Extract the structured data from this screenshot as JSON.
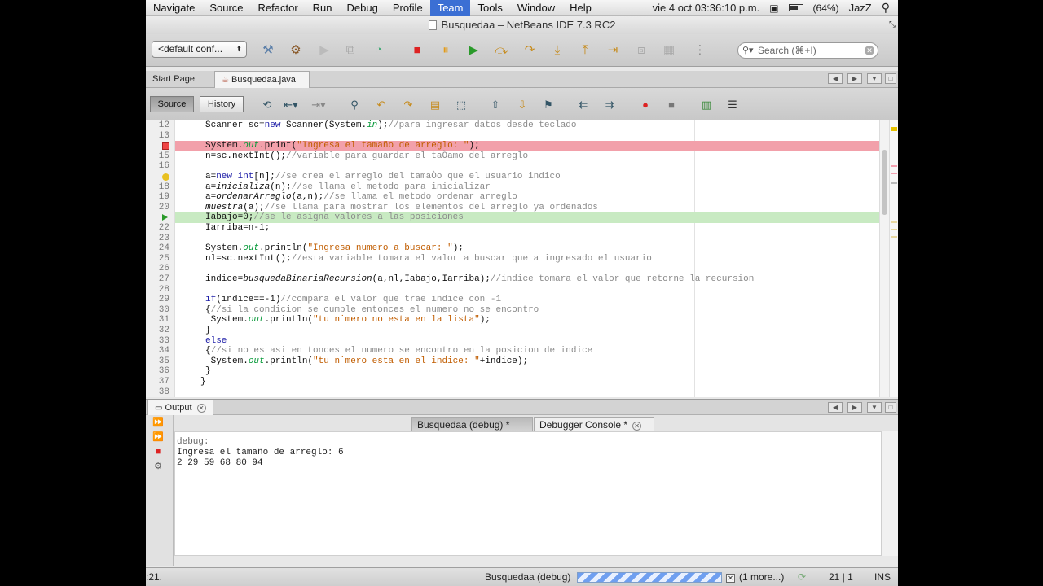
{
  "menubar": {
    "items": [
      "Navigate",
      "Source",
      "Refactor",
      "Run",
      "Debug",
      "Profile",
      "Team",
      "Tools",
      "Window",
      "Help"
    ],
    "active_index": 6,
    "clock": "vie 4 oct  03:36:10 p.m.",
    "battery": "(64%)",
    "user": "JazZ"
  },
  "window": {
    "title": "Busquedaa – NetBeans IDE 7.3 RC2"
  },
  "toolbar": {
    "config": "<default conf...",
    "search_placeholder": "Search (⌘+I)"
  },
  "editor_tabs": [
    {
      "label": "Start Page",
      "selected": false
    },
    {
      "label": "Busquedaa.java",
      "selected": true
    }
  ],
  "editor_toolbar": {
    "source_label": "Source",
    "history_label": "History"
  },
  "code": {
    "lines": [
      {
        "n": "12",
        "html": "Scanner sc=<span class='kw'>new</span> Scanner(System.<span class='fld'>in</span>);<span class='cm'>//para ingresar datos desde teclado</span>"
      },
      {
        "n": "13",
        "html": ""
      },
      {
        "n": "",
        "html": "System.<span class='fld'>out</span>.print(<span class='str'>\"Ingresa el tamaño de arreglo: \"</span>);",
        "mark": "bp"
      },
      {
        "n": "15",
        "html": "n=sc.nextInt();<span class='cm'>//variable para guardar el taÒamo del arreglo</span>"
      },
      {
        "n": "16",
        "html": ""
      },
      {
        "n": "",
        "html": "a=<span class='kw'>new int</span>[n];<span class='cm'>//se crea el arreglo del tamaÒo que el usuario indico</span>",
        "mark": "hint"
      },
      {
        "n": "18",
        "html": "a=<span class='it'>inicializa</span>(n);<span class='cm'>//se llama el metodo para inicializar</span>"
      },
      {
        "n": "19",
        "html": "a=<span class='it'>ordenarArreglo</span>(a,n);<span class='cm'>//se llama el metodo ordenar arreglo</span>"
      },
      {
        "n": "20",
        "html": "<span class='it'>muestra</span>(a);<span class='cm'>//se llama para mostrar los elementos del arreglo ya ordenados</span>"
      },
      {
        "n": "",
        "html": "Iabajo=0;<span class='cm'>//se le asigna valores a las posiciones</span>",
        "mark": "cur"
      },
      {
        "n": "22",
        "html": "Iarriba=n-1;"
      },
      {
        "n": "23",
        "html": ""
      },
      {
        "n": "24",
        "html": "System.<span class='fld'>out</span>.println(<span class='str'>\"Ingresa numero a buscar: \"</span>);"
      },
      {
        "n": "25",
        "html": "nl=sc.nextInt();<span class='cm'>//esta variable tomara el valor a buscar que a ingresado el usuario</span>"
      },
      {
        "n": "26",
        "html": ""
      },
      {
        "n": "27",
        "html": "indice=<span class='it'>busquedaBinariaRecursion</span>(a,nl,Iabajo,Iarriba);<span class='cm'>//indice tomara el valor que retorne la recursion</span>"
      },
      {
        "n": "28",
        "html": ""
      },
      {
        "n": "29",
        "html": "<span class='kw'>if</span>(indice==-1)<span class='cm'>//compara el valor que trae indice con -1</span>"
      },
      {
        "n": "30",
        "html": "{<span class='cm'>//si la condicion se cumple entonces el numero no se encontro</span>"
      },
      {
        "n": "31",
        "html": " System.<span class='fld'>out</span>.println(<span class='str'>\"tu n˙mero no esta en la lista\"</span>);"
      },
      {
        "n": "32",
        "html": "}"
      },
      {
        "n": "33",
        "html": "<span class='kw'>else</span>"
      },
      {
        "n": "34",
        "html": "{<span class='cm'>//si no es asi en tonces el numero se encontro en la posicion de indice</span>"
      },
      {
        "n": "35",
        "html": " System.<span class='fld'>out</span>.println(<span class='str'>\"tu n˙mero esta en el indice: \"</span>+indice);"
      },
      {
        "n": "36",
        "html": "}"
      },
      {
        "n": "37",
        "html": "}",
        "indent": -1
      },
      {
        "n": "38",
        "html": ""
      }
    ]
  },
  "output": {
    "panel_label": "Output",
    "tabs": [
      {
        "label": "Busquedaa (debug) *",
        "selected": true
      },
      {
        "label": "Debugger Console *",
        "selected": false
      }
    ],
    "console_lines": [
      "debug:",
      "Ingresa el tamaño de arreglo: 6",
      "2 29 59 68 80 94"
    ]
  },
  "status": {
    "left": ":21.",
    "task": "Busquedaa (debug)",
    "more": "(1 more...)",
    "position": "21 | 1",
    "mode": "INS"
  },
  "colors": {
    "breakpoint_line": "#f2a0aa",
    "current_line": "#c8eac2",
    "menu_active": "#3b6fd4"
  }
}
